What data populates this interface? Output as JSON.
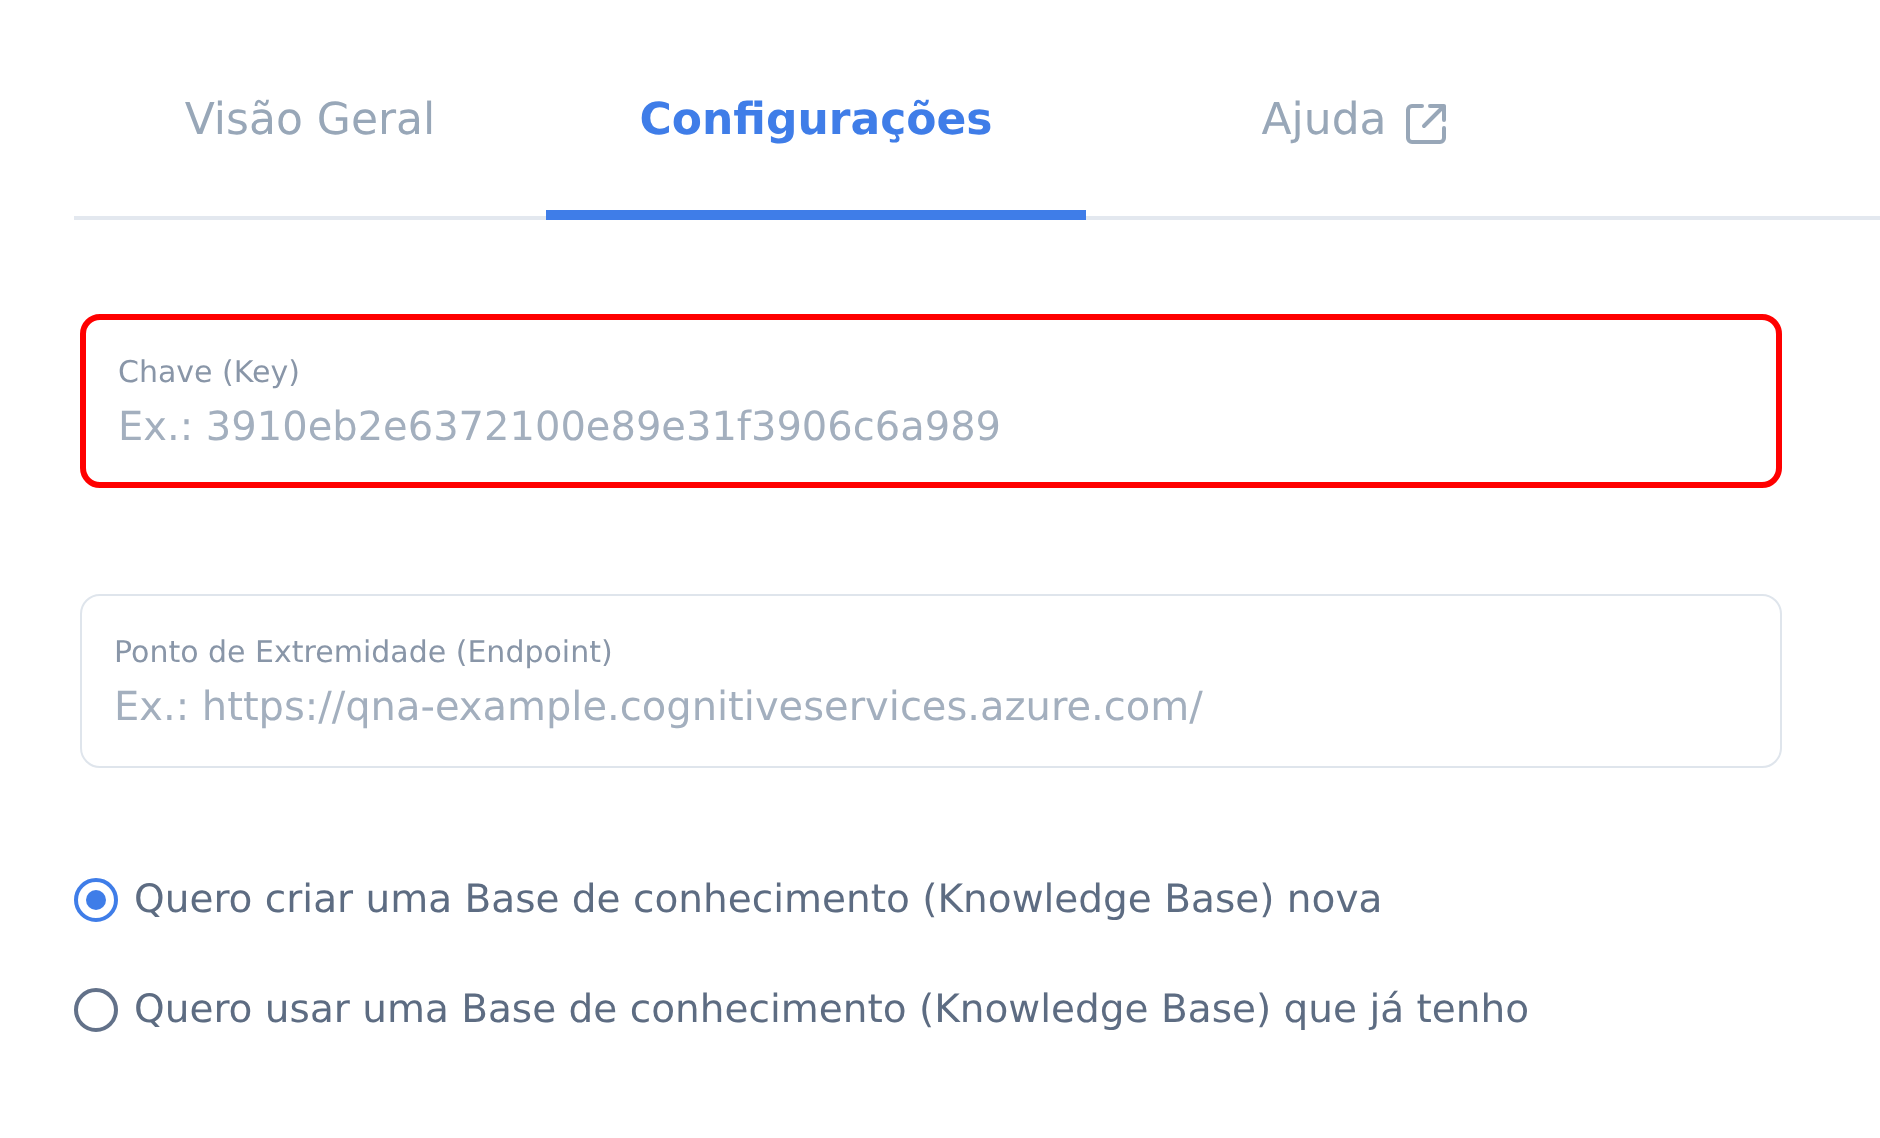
{
  "tabs": [
    {
      "label": "Visão Geral",
      "selected": false,
      "external": false
    },
    {
      "label": "Configurações",
      "selected": true,
      "external": false
    },
    {
      "label": "Ajuda",
      "selected": false,
      "external": true
    }
  ],
  "fields": [
    {
      "label": "Chave (Key)",
      "placeholder": "Ex.: 3910eb2e6372100e89e31f3906c6a989",
      "highlighted": true
    },
    {
      "label": "Ponto de Extremidade (Endpoint)",
      "placeholder": "Ex.: https://qna-example.cognitiveservices.azure.com/",
      "highlighted": false
    }
  ],
  "options": [
    {
      "label": "Quero criar uma Base de conhecimento (Knowledge Base) nova",
      "selected": true
    },
    {
      "label": "Quero usar uma Base de conhecimento (Knowledge Base) que já tenho",
      "selected": false
    }
  ]
}
